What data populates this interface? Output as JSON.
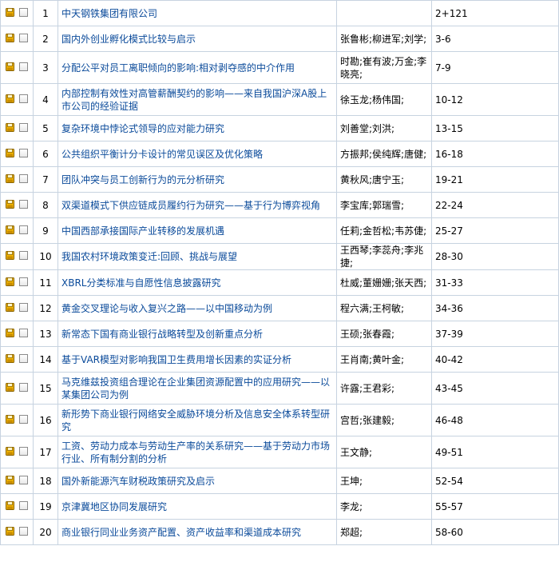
{
  "rows": [
    {
      "no": "1",
      "title": "中天钢铁集团有限公司",
      "author": "",
      "pages": "2+121",
      "tall": false
    },
    {
      "no": "2",
      "title": "国内外创业孵化模式比较与启示",
      "author": "张鲁彬;柳进军;刘学;",
      "pages": "3-6",
      "tall": false
    },
    {
      "no": "3",
      "title": "分配公平对员工离职倾向的影响:相对剥夺感的中介作用",
      "author": "时勘;崔有波;万金;李晓亮;",
      "pages": "7-9",
      "tall": true
    },
    {
      "no": "4",
      "title": "内部控制有效性对高管薪酬契约的影响——来自我国沪深A股上市公司的经验证据",
      "author": "徐玉龙;杨伟国;",
      "pages": "10-12",
      "tall": true
    },
    {
      "no": "5",
      "title": "复杂环境中悖论式领导的应对能力研究",
      "author": "刘善堂;刘洪;",
      "pages": "13-15",
      "tall": false
    },
    {
      "no": "6",
      "title": "公共组织平衡计分卡设计的常见误区及优化策略",
      "author": "方振邦;侯纯辉;唐健;",
      "pages": "16-18",
      "tall": false
    },
    {
      "no": "7",
      "title": "团队冲突与员工创新行为的元分析研究",
      "author": "黄秋风;唐宁玉;",
      "pages": "19-21",
      "tall": false
    },
    {
      "no": "8",
      "title": "双渠道模式下供应链成员履约行为研究——基于行为博弈视角",
      "author": "李宝库;郭瑞雪;",
      "pages": "22-24",
      "tall": false
    },
    {
      "no": "9",
      "title": "中国西部承接国际产业转移的发展机遇",
      "author": "任莉;金哲松;韦苏倢;",
      "pages": "25-27",
      "tall": false
    },
    {
      "no": "10",
      "title": "我国农村环境政策变迁:回顾、挑战与展望",
      "author": "王西琴;李蕊舟;李兆捷;",
      "pages": "28-30",
      "tall": false
    },
    {
      "no": "11",
      "title": "XBRL分类标准与自愿性信息披露研究",
      "author": "杜威;董姗姗;张天西;",
      "pages": "31-33",
      "tall": false
    },
    {
      "no": "12",
      "title": "黄金交叉理论与收入复兴之路——以中国移动为例",
      "author": "程六满;王柯敏;",
      "pages": "34-36",
      "tall": false
    },
    {
      "no": "13",
      "title": "新常态下国有商业银行战略转型及创新重点分析",
      "author": "王硕;张春霞;",
      "pages": "37-39",
      "tall": false
    },
    {
      "no": "14",
      "title": "基于VAR模型对影响我国卫生费用增长因素的实证分析",
      "author": "王肖南;黄叶金;",
      "pages": "40-42",
      "tall": false
    },
    {
      "no": "15",
      "title": "马克维兹投资组合理论在企业集团资源配置中的应用研究——以某集团公司为例",
      "author": "许露;王君彩;",
      "pages": "43-45",
      "tall": true
    },
    {
      "no": "16",
      "title": "新形势下商业银行网络安全威胁环境分析及信息安全体系转型研究",
      "author": "宫哲;张建毅;",
      "pages": "46-48",
      "tall": true
    },
    {
      "no": "17",
      "title": "工资、劳动力成本与劳动生产率的关系研究——基于劳动力市场行业、所有制分割的分析",
      "author": "王文静;",
      "pages": "49-51",
      "tall": true
    },
    {
      "no": "18",
      "title": "国外新能源汽车财税政策研究及启示",
      "author": "王坤;",
      "pages": "52-54",
      "tall": false
    },
    {
      "no": "19",
      "title": "京津冀地区协同发展研究",
      "author": "李龙;",
      "pages": "55-57",
      "tall": false
    },
    {
      "no": "20",
      "title": "商业银行同业业务资产配置、资产收益率和渠道成本研究",
      "author": "郑超;",
      "pages": "58-60",
      "tall": false
    }
  ]
}
